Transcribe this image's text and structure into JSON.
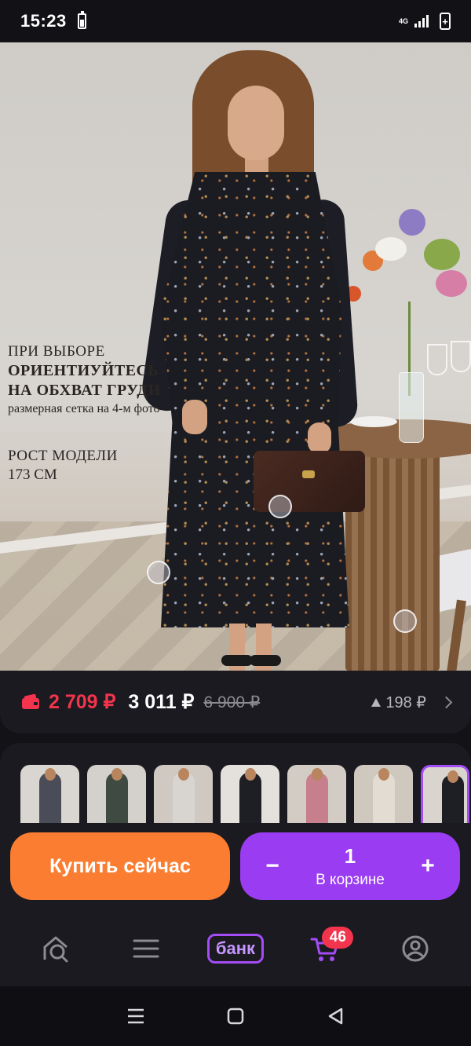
{
  "status_bar": {
    "time": "15:23",
    "network": "4G",
    "icons": [
      "battery-saver-icon",
      "signal-icon",
      "battery-charging-icon"
    ]
  },
  "hero": {
    "text_line1": "ПРИ ВЫБОРЕ",
    "text_line2": "ОРИЕНТИУЙТЕСЬ",
    "text_line3": "НА ОБХВАТ ГРУДИ",
    "text_line4": "размерная сетка на 4-м фото",
    "height_label": "РОСТ МОДЕЛИ",
    "height_value": "173 СМ"
  },
  "price": {
    "wallet_price": "2 709 ₽",
    "price": "3 011 ₽",
    "old_price": "6 900 ₽",
    "points": "198 ₽"
  },
  "thumbnails": [
    {
      "color": "#4a4c58",
      "bg": "#d9d6d2"
    },
    {
      "color": "#3f4a43",
      "bg": "#d4d0cb"
    },
    {
      "color": "#d8d4cf",
      "bg": "#cfc9c2"
    },
    {
      "color": "#1e1f25",
      "bg": "#e4e1dc"
    },
    {
      "color": "#c77f8d",
      "bg": "#d2ccc4"
    },
    {
      "color": "#e2dcd2",
      "bg": "#cfc8bf"
    },
    {
      "color": "#1e1f25",
      "bg": "#d9d4cd"
    }
  ],
  "actions": {
    "buy_now": "Купить сейчас",
    "cart_qty": "1",
    "cart_label": "В корзине",
    "minus": "−",
    "plus": "+"
  },
  "nav": {
    "items": [
      "search-catalog-icon",
      "menu-icon",
      "bank",
      "cart-icon",
      "profile-icon"
    ],
    "bank_label": "банк",
    "cart_count": "46"
  },
  "colors": {
    "accent_purple": "#9a3cf1",
    "accent_orange": "#fb7d31",
    "accent_red": "#f2344c"
  }
}
